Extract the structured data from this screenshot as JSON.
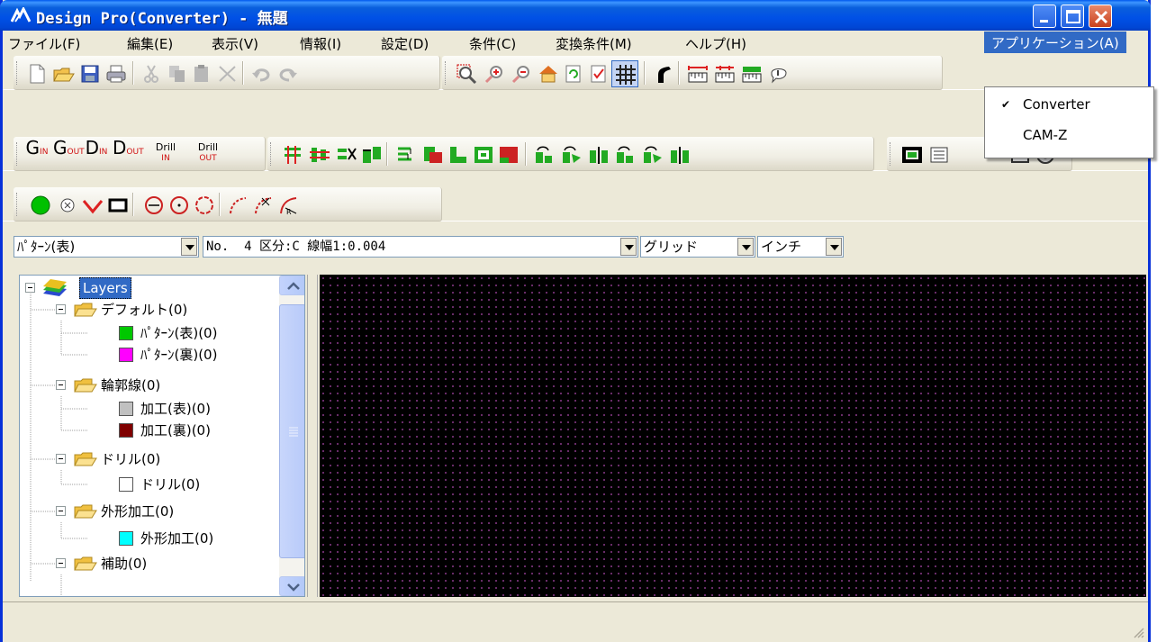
{
  "window": {
    "title": "Design Pro(Converter) - 無題"
  },
  "menu": {
    "items": [
      "ファイル(F)",
      "編集(E)",
      "表示(V)",
      "情報(I)",
      "設定(D)",
      "条件(C)",
      "変換条件(M)",
      "ヘルプ(H)"
    ],
    "app_menu": "アプリケーション(A)"
  },
  "dropdown": {
    "items": [
      {
        "label": "Converter",
        "checked": true
      },
      {
        "label": "CAM-Z",
        "checked": false
      }
    ],
    "check_mark": "✔"
  },
  "toolbar2": {
    "g_in": "G",
    "g_out": "G",
    "d_in": "D",
    "d_out": "D",
    "in_sub": "IN",
    "out_sub": "OUT",
    "drill": "Drill",
    "drill_in": "IN",
    "drill_out": "OUT"
  },
  "combos": {
    "layer": "ﾊﾟﾀｰﾝ(表)",
    "tool": "No.  4 区分:C 線幅1:0.004",
    "grid": "グリッド",
    "unit": "インチ"
  },
  "tree": {
    "root": "Layers",
    "groups": [
      {
        "label": "デフォルト(0)",
        "children": [
          {
            "label": "ﾊﾟﾀｰﾝ(表)(0)",
            "color": "#00c800"
          },
          {
            "label": "ﾊﾟﾀｰﾝ(裏)(0)",
            "color": "#ff00ff"
          }
        ]
      },
      {
        "label": "輪郭線(0)",
        "children": [
          {
            "label": "加工(表)(0)",
            "color": "#c0c0c0"
          },
          {
            "label": "加工(裏)(0)",
            "color": "#800000"
          }
        ]
      },
      {
        "label": "ドリル(0)",
        "children": [
          {
            "label": "ドリル(0)",
            "color": "#ffffff"
          }
        ]
      },
      {
        "label": "外形加工(0)",
        "children": [
          {
            "label": "外形加工(0)",
            "color": "#00ffff"
          }
        ]
      },
      {
        "label": "補助(0)",
        "children": []
      }
    ]
  },
  "colors": {
    "canvas_bg": "#000000",
    "grid_dot": "#8b3a8b",
    "menu_highlight": "#316ac5"
  }
}
